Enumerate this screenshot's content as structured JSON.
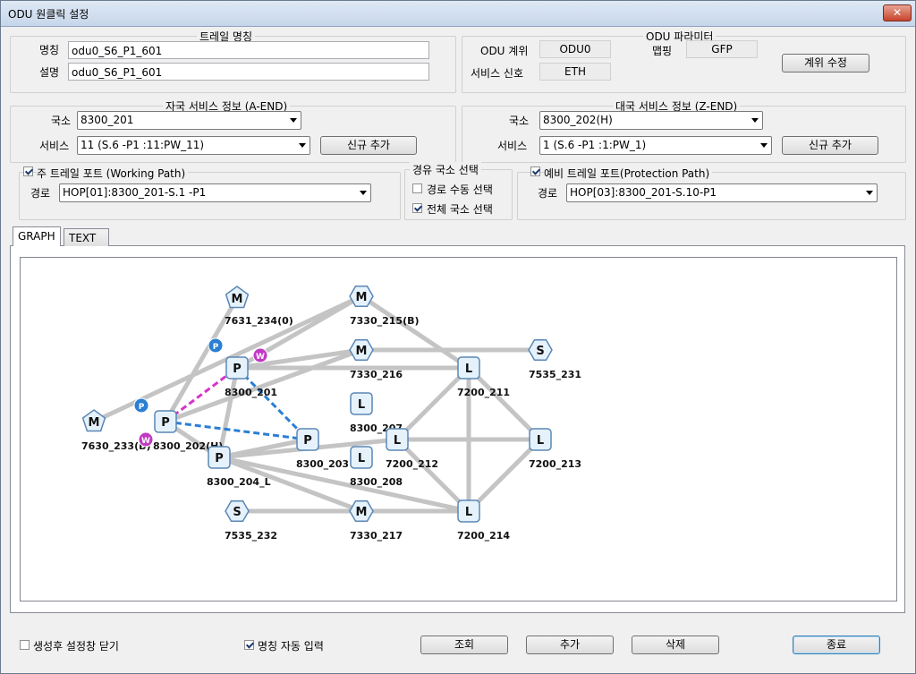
{
  "window": {
    "title": "ODU 원클릭 설정",
    "close": "✕"
  },
  "trail_name": {
    "caption": "트레일 명칭",
    "name_label": "명칭",
    "name_value": "odu0_S6_P1_601",
    "desc_label": "설명",
    "desc_value": "odu0_S6_P1_601"
  },
  "odu_params": {
    "caption": "ODU 파라미터",
    "level_label": "ODU 계위",
    "level_value": "ODU0",
    "mapping_label": "맵핑",
    "mapping_value": "GFP",
    "signal_label": "서비스 신호",
    "signal_value": "ETH",
    "edit_level_button": "계위 수정"
  },
  "a_end": {
    "caption": "자국 서비스 정보 (A-END)",
    "office_label": "국소",
    "office_value": "8300_201",
    "service_label": "서비스",
    "service_value": "11 (S.6 -P1 :11:PW_11)",
    "add_button": "신규 추가"
  },
  "z_end": {
    "caption": "대국 서비스 정보 (Z-END)",
    "office_label": "국소",
    "office_value": "8300_202(H)",
    "service_label": "서비스",
    "service_value": "1 (S.6 -P1 :1:PW_1)",
    "add_button": "신규 추가"
  },
  "working_path": {
    "caption": "주 트레일 포트 (Working Path)",
    "checked": true,
    "route_label": "경로",
    "route_value": "HOP[01]:8300_201-S.1 -P1"
  },
  "via_office": {
    "caption": "경유 국소 선택",
    "manual_label": "경로 수동 선택",
    "manual_checked": false,
    "all_label": "전체 국소 선택",
    "all_checked": true
  },
  "protection_path": {
    "caption": "예비 트레일 포트(Protection Path)",
    "checked": true,
    "route_label": "경로",
    "route_value": "HOP[03]:8300_201-S.10-P1"
  },
  "tabs": [
    {
      "label": "GRAPH",
      "active": true
    },
    {
      "label": "TEXT",
      "active": false
    }
  ],
  "graph": {
    "colors": {
      "link": "#c4c4c4",
      "working": "#d633c8",
      "protection": "#2a7fd4",
      "node_border": "#5a87b5",
      "node_fill": "#e6f2fb"
    },
    "nodes": [
      {
        "id": "7631_234",
        "label": "7631_234(0)",
        "glyph": "M",
        "shape": "pentagon"
      },
      {
        "id": "7330_215",
        "label": "7330_215(B)",
        "glyph": "M",
        "shape": "hexagon"
      },
      {
        "id": "7330_216",
        "label": "7330_216",
        "glyph": "M",
        "shape": "hexagon"
      },
      {
        "id": "7535_231",
        "label": "7535_231",
        "glyph": "S",
        "shape": "hexagon"
      },
      {
        "id": "8300_201",
        "label": "8300_201",
        "glyph": "P",
        "shape": "square"
      },
      {
        "id": "7200_211",
        "label": "7200_211",
        "glyph": "L",
        "shape": "square"
      },
      {
        "id": "8300_207",
        "label": "8300_207",
        "glyph": "L",
        "shape": "square"
      },
      {
        "id": "7630_233",
        "label": "7630_233(B)",
        "glyph": "M",
        "shape": "pentagon"
      },
      {
        "id": "8300_202",
        "label": "8300_202(H)",
        "glyph": "P",
        "shape": "square"
      },
      {
        "id": "8300_203",
        "label": "8300_203",
        "glyph": "P",
        "shape": "square"
      },
      {
        "id": "7200_212",
        "label": "7200_212",
        "glyph": "L",
        "shape": "square"
      },
      {
        "id": "7200_213",
        "label": "7200_213",
        "glyph": "L",
        "shape": "square"
      },
      {
        "id": "8300_204",
        "label": "8300_204_L",
        "glyph": "P",
        "shape": "square"
      },
      {
        "id": "8300_208",
        "label": "8300_208",
        "glyph": "L",
        "shape": "square"
      },
      {
        "id": "7535_232",
        "label": "7535_232",
        "glyph": "S",
        "shape": "hexagon"
      },
      {
        "id": "7330_217",
        "label": "7330_217",
        "glyph": "M",
        "shape": "hexagon"
      },
      {
        "id": "7200_214",
        "label": "7200_214",
        "glyph": "L",
        "shape": "square"
      }
    ],
    "links": [
      [
        "7630_233",
        "7330_215"
      ],
      [
        "7631_234",
        "8300_202"
      ],
      [
        "7330_215",
        "8300_201"
      ],
      [
        "7330_215",
        "7200_211"
      ],
      [
        "7330_216",
        "7535_231"
      ],
      [
        "8300_201",
        "7200_211"
      ],
      [
        "8300_201",
        "7330_216"
      ],
      [
        "8300_201",
        "8300_204"
      ],
      [
        "8300_202",
        "7330_216"
      ],
      [
        "8300_202",
        "8300_204"
      ],
      [
        "8300_204",
        "8300_203"
      ],
      [
        "8300_204",
        "7200_214"
      ],
      [
        "8300_204",
        "7330_217"
      ],
      [
        "8300_204",
        "7200_212"
      ],
      [
        "7535_232",
        "7330_217"
      ],
      [
        "7330_217",
        "7200_214"
      ],
      [
        "7200_211",
        "7200_212"
      ],
      [
        "7200_211",
        "7200_213"
      ],
      [
        "7200_211",
        "7200_214"
      ],
      [
        "7200_212",
        "7200_213"
      ],
      [
        "7200_212",
        "7200_214"
      ],
      [
        "7200_213",
        "7200_214"
      ]
    ],
    "working_links": [
      [
        "8300_202",
        "8300_201"
      ]
    ],
    "protection_links": [
      [
        "8300_201",
        "8300_203"
      ],
      [
        "8300_202",
        "8300_203"
      ]
    ],
    "markers": [
      {
        "type": "P",
        "color": "#2a7fd4"
      },
      {
        "type": "P",
        "color": "#2a7fd4"
      },
      {
        "type": "W",
        "color": "#c13ac4"
      },
      {
        "type": "W",
        "color": "#c13ac4"
      }
    ]
  },
  "footer": {
    "close_after_label": "생성후 설정창 닫기",
    "close_after_checked": false,
    "auto_name_label": "명칭 자동 입력",
    "auto_name_checked": true,
    "query_button": "조회",
    "add_button": "추가",
    "delete_button": "삭제",
    "exit_button": "종료"
  }
}
